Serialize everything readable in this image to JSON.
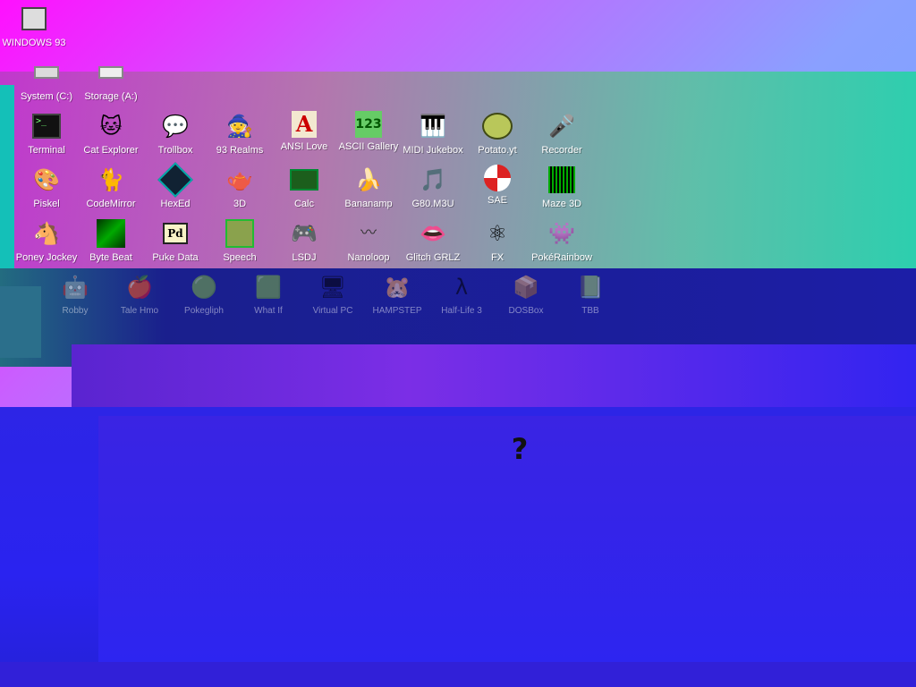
{
  "desktop": {
    "top_icon": {
      "label": "WINDOWS 93",
      "icon": "computer-icon"
    },
    "drives": [
      {
        "label": "System (C:)",
        "icon": "drive-icon"
      },
      {
        "label": "Storage (A:)",
        "icon": "floppy-icon"
      }
    ],
    "apps_row1": [
      {
        "label": "Terminal",
        "icon": "terminal-icon"
      },
      {
        "label": "Cat Explorer",
        "icon": "cat-explorer-icon"
      },
      {
        "label": "Trollbox",
        "icon": "trollbox-icon"
      },
      {
        "label": "93 Realms",
        "icon": "realms-icon"
      },
      {
        "label": "ANSI Love",
        "icon": "ansi-love-icon"
      },
      {
        "label": "ASCII Gallery",
        "icon": "ascii-gallery-icon"
      },
      {
        "label": "MIDI Jukebox",
        "icon": "midi-jukebox-icon"
      },
      {
        "label": "Potato.yt",
        "icon": "potato-icon"
      },
      {
        "label": "Recorder",
        "icon": "microphone-icon"
      }
    ],
    "apps_row2": [
      {
        "label": "Piskel",
        "icon": "palette-icon"
      },
      {
        "label": "CodeMirror",
        "icon": "codemirror-icon"
      },
      {
        "label": "HexEd",
        "icon": "hexed-icon"
      },
      {
        "label": "3D",
        "icon": "teapot-icon"
      },
      {
        "label": "Calc",
        "icon": "calculator-icon"
      },
      {
        "label": "Bananamp",
        "icon": "banana-icon"
      },
      {
        "label": "G80.M3U",
        "icon": "playlist-icon"
      },
      {
        "label": "SAE",
        "icon": "checker-ball-icon"
      },
      {
        "label": "Maze 3D",
        "icon": "maze-icon"
      }
    ],
    "apps_row3": [
      {
        "label": "Poney Jockey",
        "icon": "pony-icon"
      },
      {
        "label": "Byte Beat",
        "icon": "bytebeat-icon"
      },
      {
        "label": "Puke Data",
        "icon": "pd-icon"
      },
      {
        "label": "Speech",
        "icon": "speech-icon"
      },
      {
        "label": "LSDJ",
        "icon": "lsdj-icon"
      },
      {
        "label": "Nanoloop",
        "icon": "nanoloop-icon"
      },
      {
        "label": "Glitch GRLZ",
        "icon": "lips-icon"
      },
      {
        "label": "FX",
        "icon": "atom-icon"
      },
      {
        "label": "PokéRainbow",
        "icon": "pokemon-icon"
      }
    ],
    "apps_row4_glitched": [
      {
        "label": "Robby",
        "icon": "robot-icon"
      },
      {
        "label": "Tale Hmo",
        "icon": "tale-icon"
      },
      {
        "label": "Pokegliph",
        "icon": "glyph-icon"
      },
      {
        "label": "What If",
        "icon": "whatif-icon"
      },
      {
        "label": "Virtual PC",
        "icon": "virtual-pc-icon"
      },
      {
        "label": "HAMPSTEP",
        "icon": "hamster-icon"
      },
      {
        "label": "Half-Life 3",
        "icon": "halflife-icon"
      },
      {
        "label": "DOSBox",
        "icon": "dosbox-icon"
      },
      {
        "label": "TBB",
        "icon": "book-icon"
      }
    ],
    "glitch_question": "?"
  }
}
